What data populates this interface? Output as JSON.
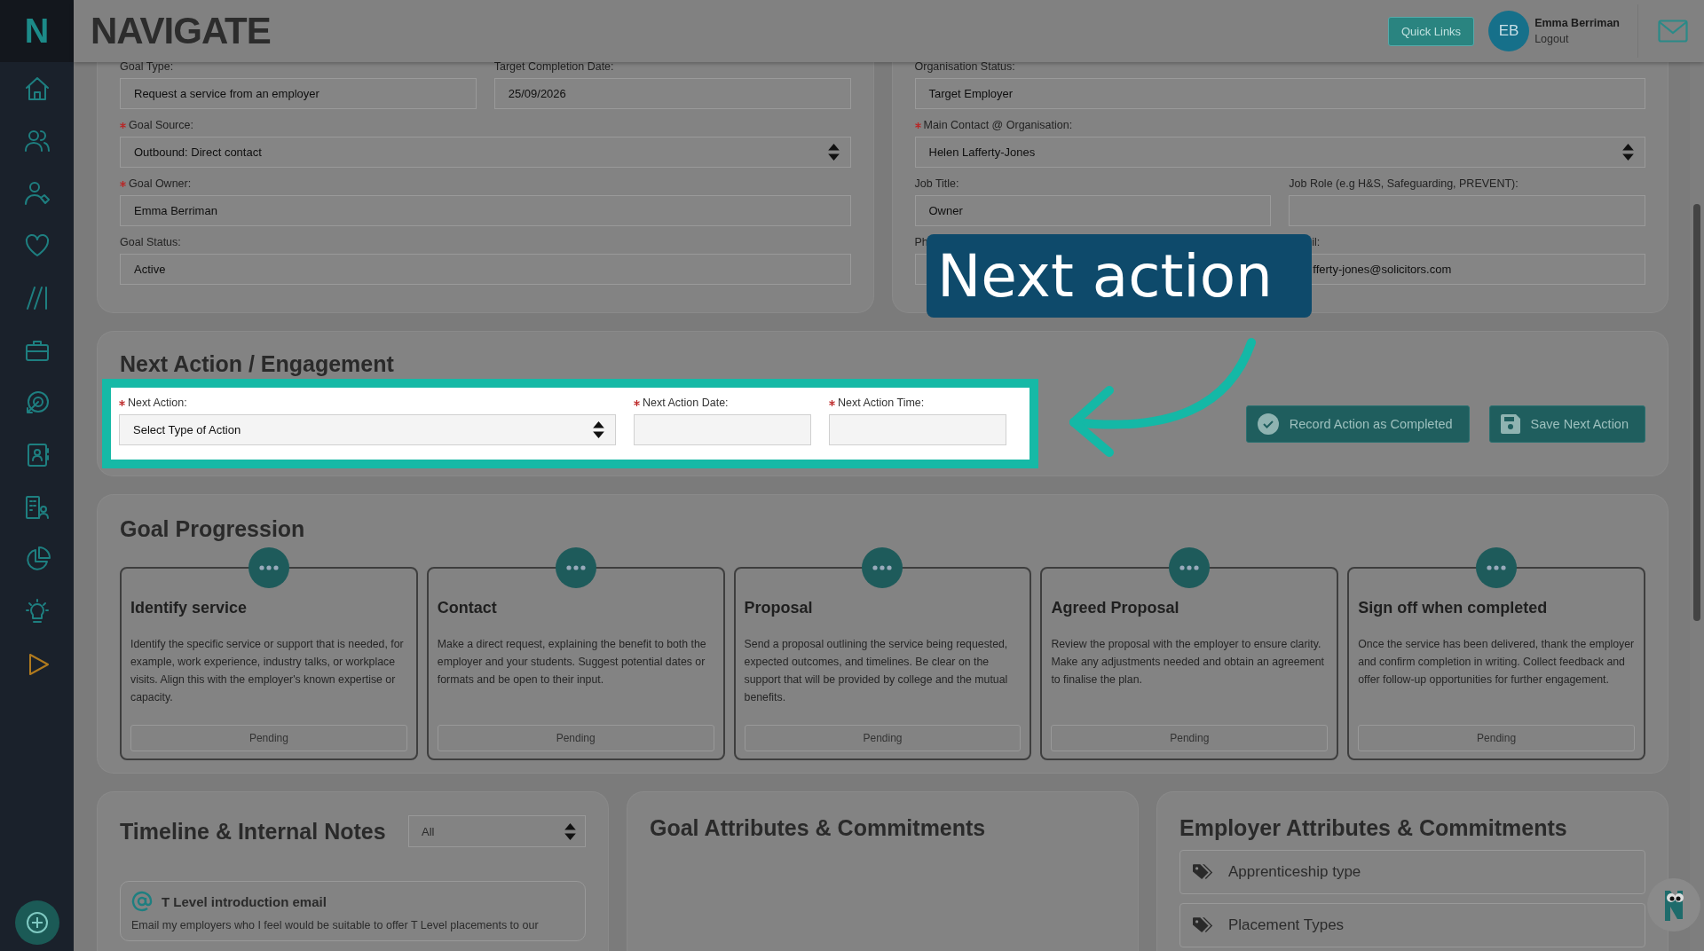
{
  "header": {
    "logo": "NAVIGATE",
    "quick_links": "Quick Links",
    "user": {
      "initials": "EB",
      "name": "Emma Berriman",
      "logout": "Logout"
    }
  },
  "sidebar": {
    "logo": "N"
  },
  "goal_details": {
    "rows": [
      [
        {
          "label": "Goal Type:",
          "kind": "text",
          "value": "Request a service from an employer"
        },
        {
          "label": "Target Completion Date:",
          "kind": "text",
          "value": "25/09/2026"
        }
      ],
      [
        {
          "label": "Goal Source:",
          "required": true,
          "kind": "select",
          "value": "Outbound: Direct contact"
        }
      ],
      [
        {
          "label": "Goal Owner:",
          "required": true,
          "kind": "text",
          "value": "Emma Berriman"
        }
      ],
      [
        {
          "label": "Goal Status:",
          "kind": "text",
          "value": "Active"
        }
      ]
    ]
  },
  "organisation": {
    "rows": [
      [
        {
          "label": "Organisation Status:",
          "kind": "text",
          "value": "Target Employer"
        }
      ],
      [
        {
          "label": "Main Contact @ Organisation:",
          "required": true,
          "kind": "select",
          "value": "Helen Lafferty-Jones"
        }
      ],
      [
        {
          "label": "Job Title:",
          "kind": "text",
          "value": "Owner"
        },
        {
          "label": "Job Role (e.g H&S, Safeguarding, PREVENT):",
          "kind": "text"
        }
      ],
      [
        {
          "label": "Ph",
          "kind": "text"
        },
        {
          "label": "il:",
          "kind": "text",
          "value": "fferty-jones@solicitors.com"
        }
      ]
    ]
  },
  "next_action": {
    "title": "Next Action / Engagement",
    "fields": [
      {
        "label": "Next Action:",
        "required": true,
        "kind": "select",
        "value": "Select Type of Action"
      },
      {
        "label": "Next Action Date:",
        "required": true,
        "kind": "text"
      },
      {
        "label": "Next Action Time:",
        "required": true,
        "kind": "text"
      }
    ],
    "buttons": [
      {
        "label": "Record Action as Completed",
        "kind": "check"
      },
      {
        "label": "Save Next Action",
        "kind": "save"
      }
    ]
  },
  "goal_progression": {
    "title": "Goal Progression",
    "stages": [
      {
        "title": "Identify service",
        "description": "Identify the specific service or support that is needed, for example, work experience, industry talks, or workplace visits. Align this with the employer's known expertise or capacity.",
        "status": "Pending"
      },
      {
        "title": "Contact",
        "description": "Make a direct request, explaining the benefit to both the employer and your students. Suggest potential dates or formats and be open to their input.",
        "status": "Pending"
      },
      {
        "title": "Proposal",
        "description": "Send a proposal outlining the service being requested, expected outcomes, and timelines. Be clear on the support that will be provided by college and the mutual benefits.",
        "status": "Pending"
      },
      {
        "title": "Agreed Proposal",
        "description": "Review the proposal with the employer to ensure clarity. Make any adjustments needed and obtain an agreement to finalise the plan.",
        "status": "Pending"
      },
      {
        "title": "Sign off when completed",
        "description": "Once the service has been delivered, thank the employer and confirm completion in writing. Collect feedback and offer follow-up opportunities for further engagement.",
        "status": "Pending"
      }
    ]
  },
  "timeline": {
    "title": "Timeline & Internal Notes",
    "filter": "All",
    "notes": [
      {
        "title": "T Level introduction email",
        "text": "Email my employers who I feel would be suitable to offer T Level placements to our"
      }
    ]
  },
  "goal_attributes": {
    "title": "Goal Attributes & Commitments"
  },
  "employer_attributes": {
    "title": "Employer Attributes & Commitments",
    "items": [
      "Apprenticeship type",
      "Placement Types"
    ]
  },
  "callout": {
    "text": "Next action"
  }
}
